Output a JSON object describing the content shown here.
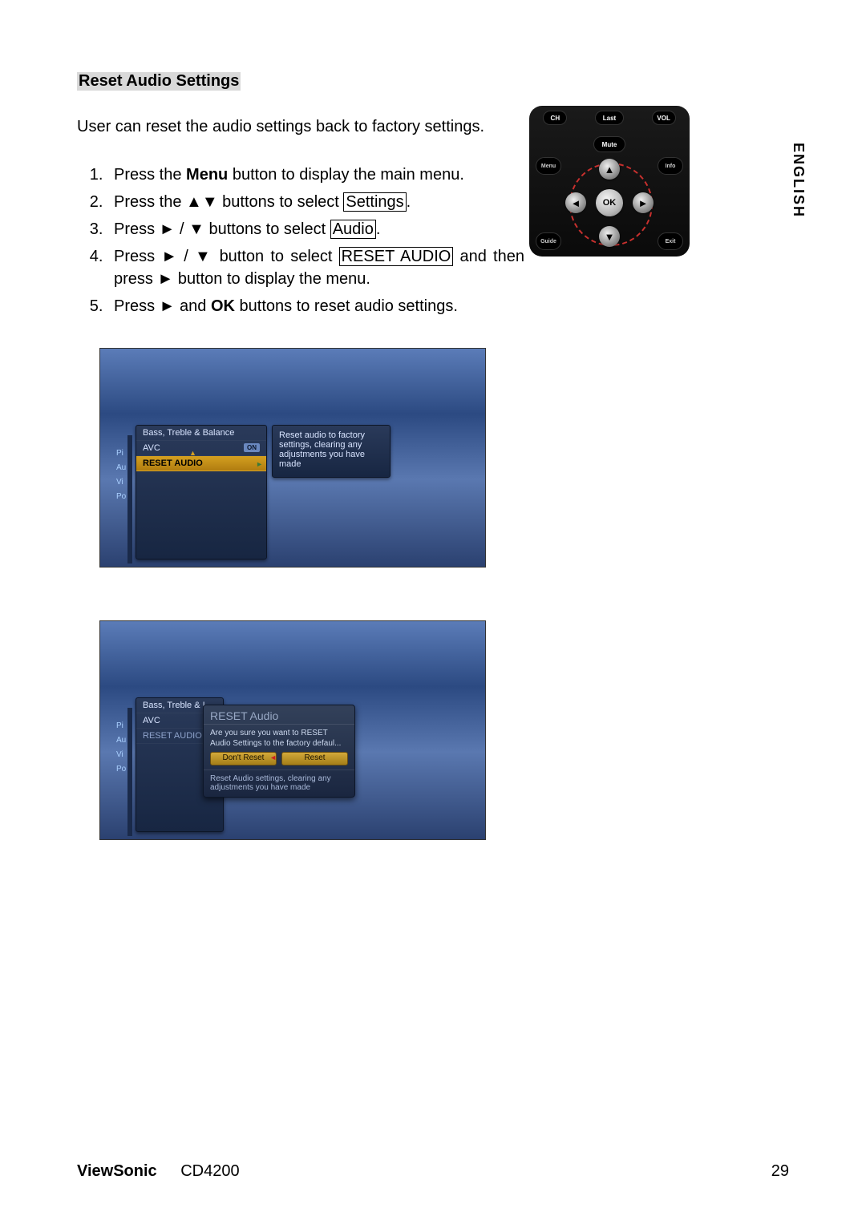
{
  "section_title": "Reset Audio Settings",
  "intro": "User can reset the audio settings back to factory settings.",
  "steps": {
    "s1_a": "Press the ",
    "s1_menu": "Menu",
    "s1_b": " button to display the main menu.",
    "s2_a": "Press the ▲▼ buttons to select ",
    "s2_box": "Settings",
    "s2_b": ".",
    "s3_a": "Press ► / ▼ buttons to select ",
    "s3_box": "Audio",
    "s3_b": ".",
    "s4_a": "Press ► / ▼ button to select ",
    "s4_box": "RESET AUDIO",
    "s4_b": " and then press ► button to display the menu.",
    "s5_a": "Press ► and ",
    "s5_ok": "OK",
    "s5_b": " buttons to reset audio settings."
  },
  "lang": "ENGLISH",
  "remote": {
    "ch": "CH",
    "last": "Last",
    "vol": "VOL",
    "mute": "Mute",
    "menu": "Menu",
    "info": "Info",
    "guide": "Guide",
    "exit": "Exit",
    "ok": "OK",
    "up": "▲",
    "down": "▼",
    "left": "◄",
    "right": "►"
  },
  "osd1": {
    "menu": {
      "row1": "Bass, Treble & Balance",
      "row2": "AVC",
      "row3": "RESET AUDIO"
    },
    "side": [
      "Pi",
      "Au",
      "Vi",
      "Po"
    ],
    "desc": "Reset audio to factory settings, clearing any adjustments you have made"
  },
  "osd2": {
    "menu": {
      "row1": "Bass, Treble & I",
      "row2": "AVC",
      "row3": "RESET AUDIO"
    },
    "side": [
      "Pi",
      "Au",
      "Vi",
      "Po"
    ],
    "dialog": {
      "title": "RESET Audio",
      "body": "Are you sure you want to RESET Audio Settings to the factory defaul...",
      "btn_dont": "Don't Reset",
      "btn_reset": "Reset",
      "foot": "Reset Audio settings, clearing any adjustments you have made"
    }
  },
  "footer": {
    "brand": "ViewSonic",
    "model": "CD4200",
    "page": "29"
  }
}
